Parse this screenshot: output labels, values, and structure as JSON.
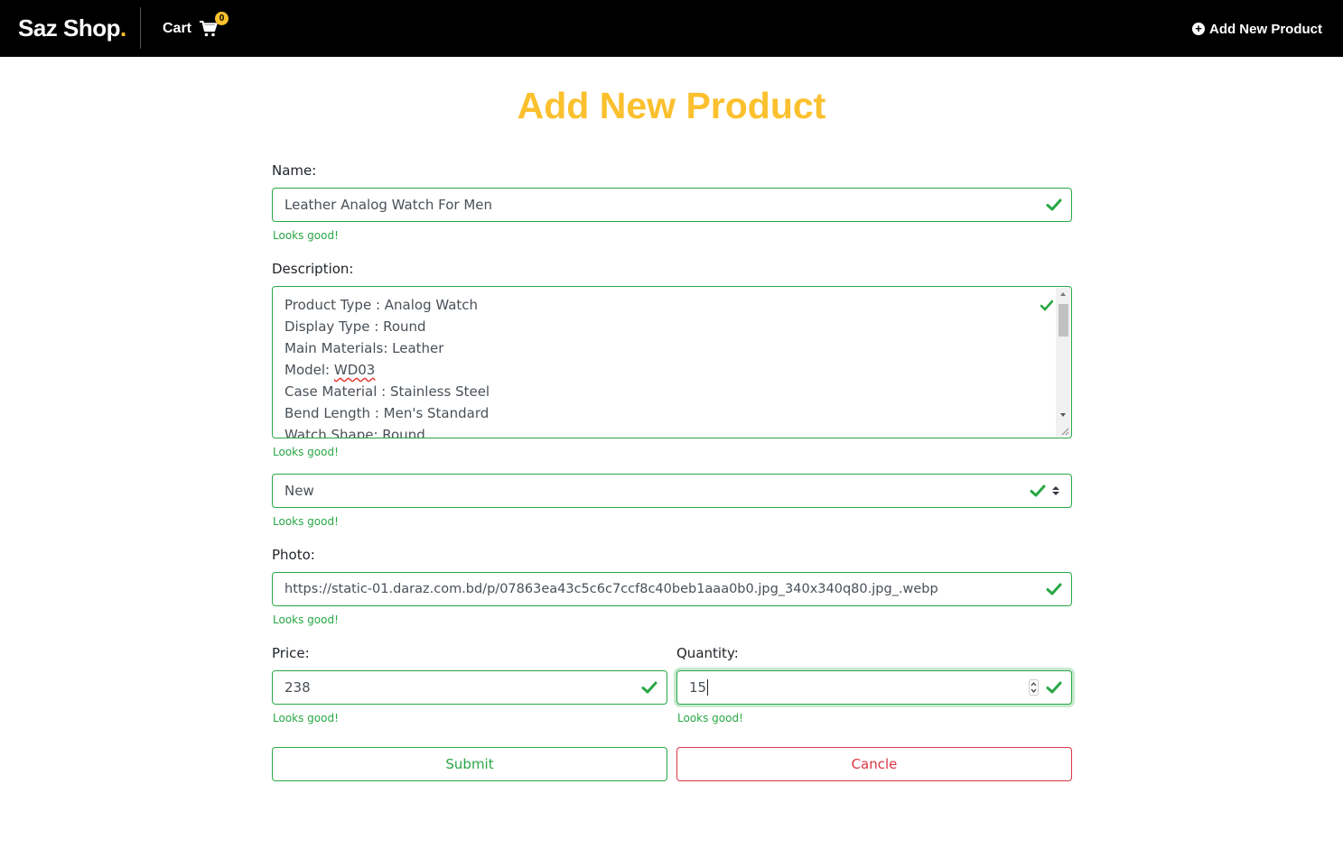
{
  "navbar": {
    "brand": "Saz Shop",
    "brand_dot": ".",
    "cart_label": "Cart",
    "cart_count": "0",
    "add_product_label": "Add New Product"
  },
  "page": {
    "title": "Add New Product"
  },
  "form": {
    "name": {
      "label": "Name:",
      "value": "Leather Analog Watch For Men",
      "feedback": "Looks good!"
    },
    "description": {
      "label": "Description:",
      "lines": {
        "0": "Product Type : Analog Watch",
        "1": "Display Type : Round",
        "2": "Main Materials: Leather",
        "3_prefix": "Model: ",
        "3_spell": "WD03",
        "4": "Case Material : Stainless Steel",
        "5": "Bend Length : Men's Standard",
        "6": "Watch Shape: Round"
      },
      "feedback": "Looks good!"
    },
    "condition": {
      "selected": "New",
      "feedback": "Looks good!"
    },
    "photo": {
      "label": "Photo:",
      "value": "https://static-01.daraz.com.bd/p/07863ea43c5c6c7ccf8c40beb1aaa0b0.jpg_340x340q80.jpg_.webp",
      "feedback": "Looks good!"
    },
    "price": {
      "label": "Price:",
      "value": "238",
      "feedback": "Looks good!"
    },
    "quantity": {
      "label": "Quantity:",
      "value": "15",
      "feedback": "Looks good!"
    },
    "submit_label": "Submit",
    "cancel_label": "Cancle"
  },
  "colors": {
    "accent": "#fbc02d",
    "valid": "#28a745",
    "danger": "#dc3545",
    "navbar": "#000000"
  }
}
